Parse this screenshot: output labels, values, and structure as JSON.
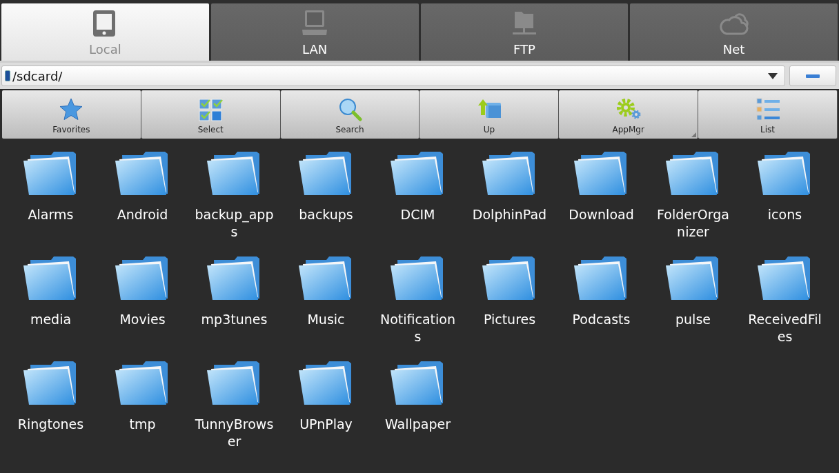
{
  "tabs": [
    {
      "label": "Local",
      "kind": "tablet",
      "selected": true
    },
    {
      "label": "LAN",
      "kind": "computer",
      "selected": false
    },
    {
      "label": "FTP",
      "kind": "server",
      "selected": false
    },
    {
      "label": "Net",
      "kind": "cloud",
      "selected": false
    }
  ],
  "path_bar": {
    "path": "/sdcard/"
  },
  "toolbar": [
    {
      "label": "Favorites",
      "kind": "star"
    },
    {
      "label": "Select",
      "kind": "checks"
    },
    {
      "label": "Search",
      "kind": "search"
    },
    {
      "label": "Up",
      "kind": "up"
    },
    {
      "label": "AppMgr",
      "kind": "gears",
      "has_menu": true
    },
    {
      "label": "List",
      "kind": "list"
    }
  ],
  "folders": [
    {
      "name": "Alarms"
    },
    {
      "name": "Android"
    },
    {
      "name": "backup_apps"
    },
    {
      "name": "backups"
    },
    {
      "name": "DCIM"
    },
    {
      "name": "DolphinPad"
    },
    {
      "name": "Download"
    },
    {
      "name": "FolderOrganizer"
    },
    {
      "name": "icons"
    },
    {
      "name": "media"
    },
    {
      "name": "Movies"
    },
    {
      "name": "mp3tunes"
    },
    {
      "name": "Music"
    },
    {
      "name": "Notifications"
    },
    {
      "name": "Pictures"
    },
    {
      "name": "Podcasts"
    },
    {
      "name": "pulse"
    },
    {
      "name": "ReceivedFiles"
    },
    {
      "name": "Ringtones"
    },
    {
      "name": "tmp"
    },
    {
      "name": "TunnyBrowser"
    },
    {
      "name": "UPnPlay"
    },
    {
      "name": "Wallpaper"
    }
  ]
}
